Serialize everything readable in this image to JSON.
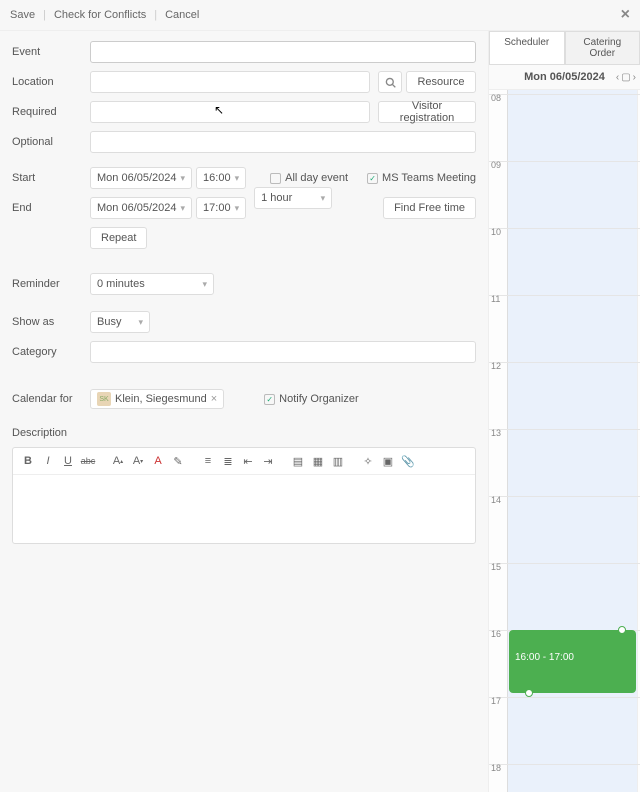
{
  "topbar": {
    "save": "Save",
    "check": "Check for Conflicts",
    "cancel": "Cancel"
  },
  "labels": {
    "event": "Event",
    "location": "Location",
    "required": "Required",
    "optional": "Optional",
    "start": "Start",
    "end": "End",
    "reminder": "Reminder",
    "showas": "Show as",
    "category": "Category",
    "calendarfor": "Calendar for",
    "description": "Description"
  },
  "buttons": {
    "resource": "Resource",
    "visitorreg": "Visitor registration",
    "repeat": "Repeat",
    "findfree": "Find Free time"
  },
  "date": {
    "start_date": "Mon 06/05/2024",
    "start_time": "16:00",
    "end_date": "Mon 06/05/2024",
    "end_time": "17:00",
    "duration": "1 hour"
  },
  "checks": {
    "allday": "All day event",
    "msteams": "MS Teams Meeting",
    "notify": "Notify Organizer"
  },
  "reminder": {
    "value": "0 minutes"
  },
  "showas": {
    "value": "Busy"
  },
  "calendarfor": {
    "chip_initials": "SK",
    "chip_name": "Klein, Siegesmund"
  },
  "tabs": {
    "scheduler": "Scheduler",
    "catering": "Catering Order"
  },
  "scheduler": {
    "date": "Mon 06/05/2024",
    "hours": [
      "08",
      "09",
      "10",
      "11",
      "12",
      "13",
      "14",
      "15",
      "16",
      "17",
      "18"
    ],
    "event_label": "16:00 - 17:00"
  },
  "chart_data": {
    "type": "timeline",
    "date": "Mon 06/05/2024",
    "hours_range": [
      8,
      18
    ],
    "events": [
      {
        "start": "16:00",
        "end": "17:00",
        "label": "16:00 - 17:00",
        "color": "#4caf50"
      }
    ]
  }
}
